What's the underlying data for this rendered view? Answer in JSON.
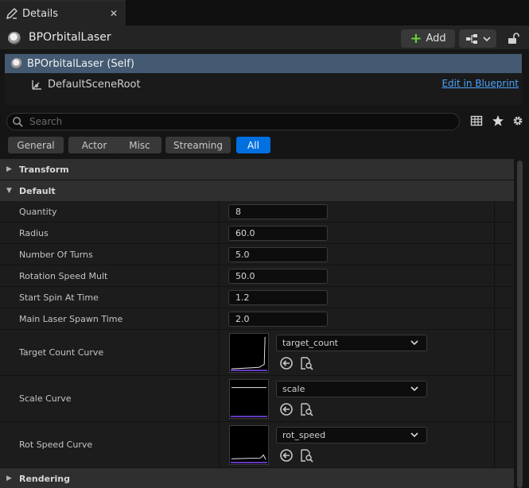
{
  "tab": {
    "title": "Details",
    "icon": "pencil-icon",
    "close": "✕"
  },
  "header": {
    "actor_name": "BPOrbitalLaser",
    "add_label": "Add"
  },
  "tree": {
    "self_label": "BPOrbitalLaser (Self)",
    "root_label": "DefaultSceneRoot",
    "edit_link": "Edit in Blueprint"
  },
  "search": {
    "placeholder": "Search"
  },
  "filters": [
    {
      "label": "General",
      "active": false
    },
    {
      "label": "Actor",
      "active": false
    },
    {
      "label": "Misc",
      "active": false
    },
    {
      "label": "Streaming",
      "active": false
    },
    {
      "label": "All",
      "active": true
    }
  ],
  "categories": {
    "transform": "Transform",
    "default": "Default",
    "rendering": "Rendering"
  },
  "properties": [
    {
      "name": "Quantity",
      "value": "8"
    },
    {
      "name": "Radius",
      "value": "60.0"
    },
    {
      "name": "Number Of Turns",
      "value": "5.0"
    },
    {
      "name": "Rotation Speed Mult",
      "value": "50.0"
    },
    {
      "name": "Start Spin At Time",
      "value": "1.2"
    },
    {
      "name": "Main Laser Spawn Time",
      "value": "2.0"
    }
  ],
  "curves": [
    {
      "name": "Target Count Curve",
      "asset": "target_count"
    },
    {
      "name": "Scale Curve",
      "asset": "scale"
    },
    {
      "name": "Rot Speed Curve",
      "asset": "rot_speed"
    }
  ],
  "colors": {
    "accent": "#0070e0",
    "selection": "#435a72",
    "add_plus": "#6fcf3c",
    "link": "#4aa3ff",
    "curve_baseline": "#6a3fc8"
  }
}
